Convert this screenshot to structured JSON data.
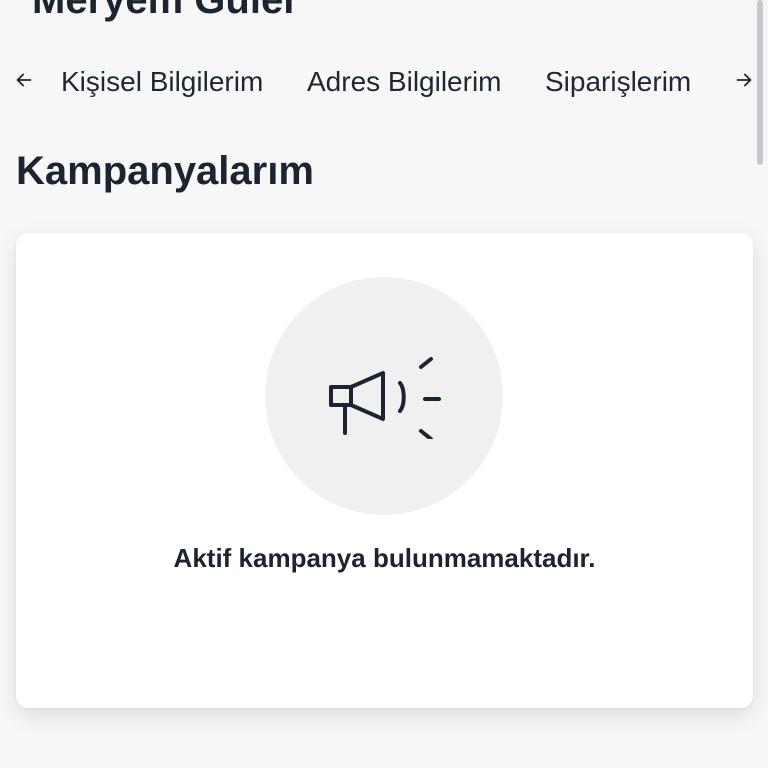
{
  "user": {
    "name": "Meryem Güler"
  },
  "tabs": {
    "prev_icon": "arrow-left-icon",
    "next_icon": "arrow-right-icon",
    "items": [
      {
        "label": "Kişisel Bilgilerim"
      },
      {
        "label": "Adres Bilgilerim"
      },
      {
        "label": "Siparişlerim"
      }
    ]
  },
  "section": {
    "title": "Kampanyalarım"
  },
  "empty_state": {
    "icon": "megaphone-icon",
    "message": "Aktif kampanya bulunmamaktadır."
  },
  "colors": {
    "text": "#1b2430",
    "background": "#f7f7f8",
    "card": "#ffffff",
    "icon_circle": "#f0f0f1"
  }
}
